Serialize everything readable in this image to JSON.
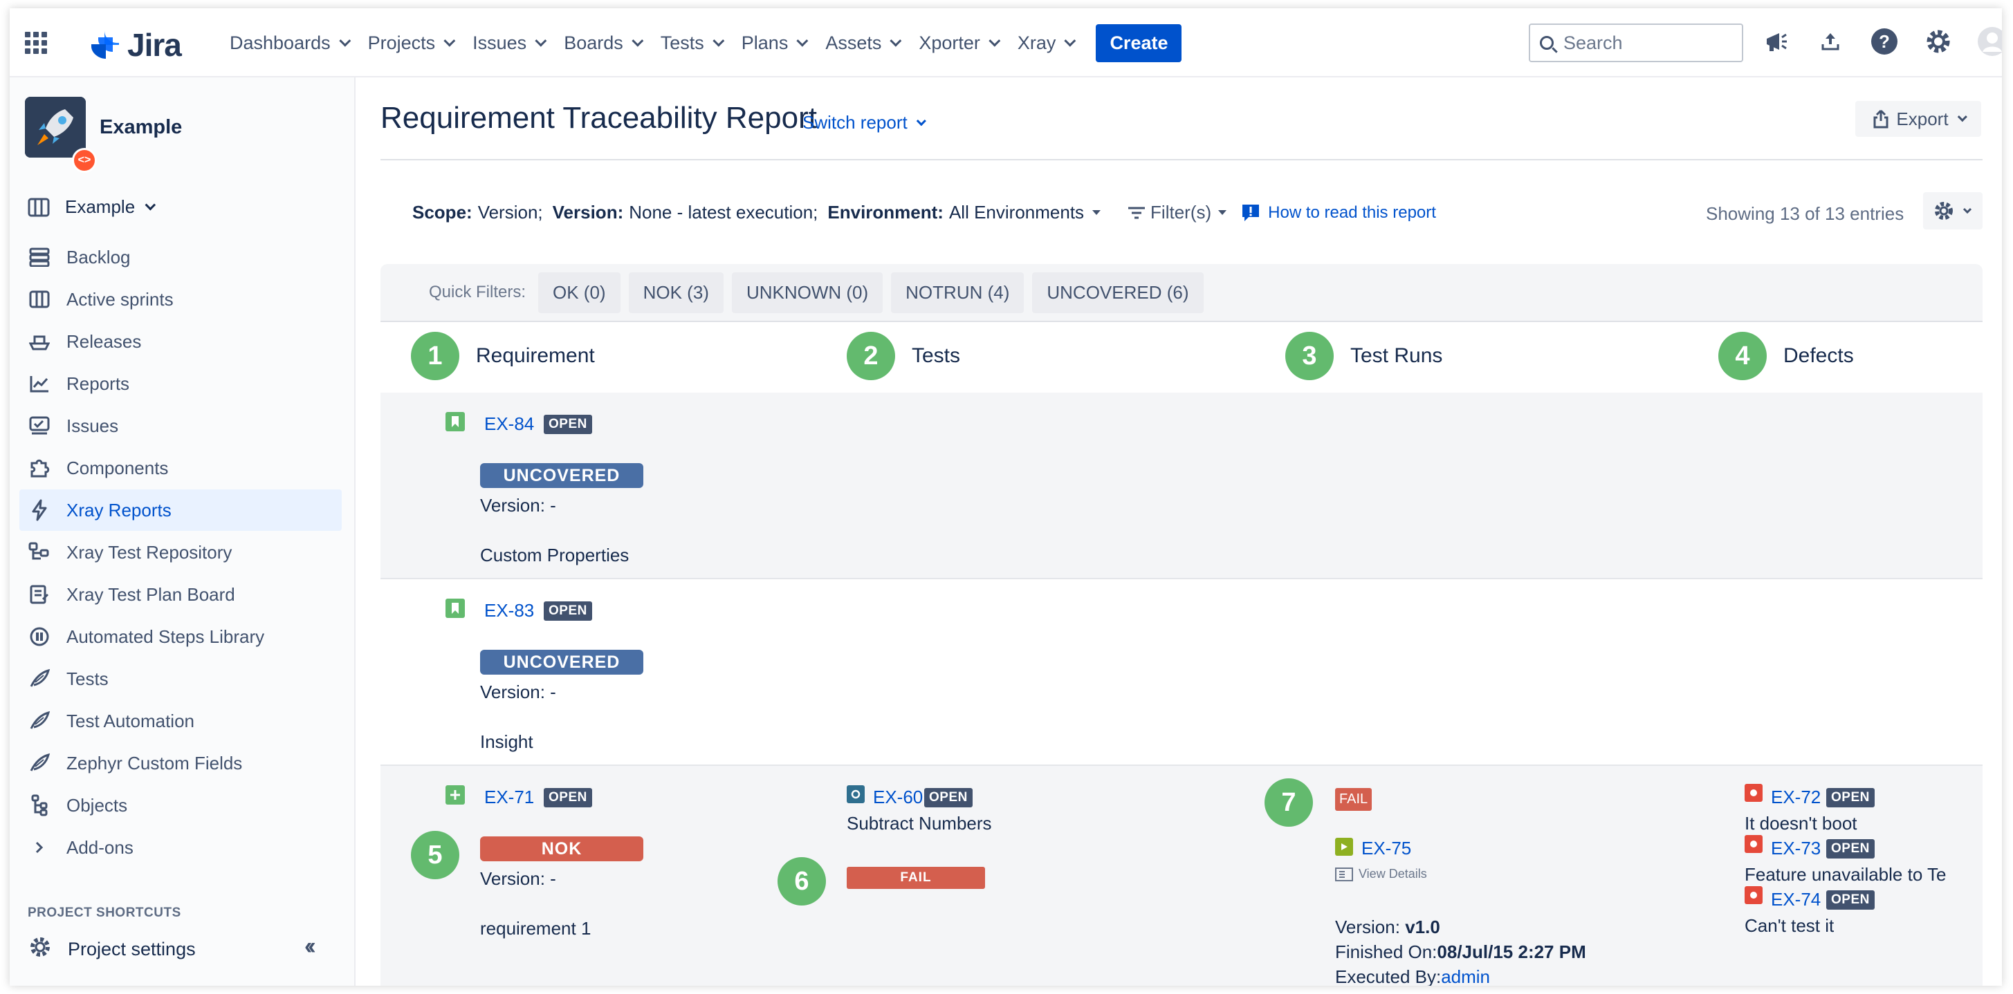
{
  "topnav": {
    "logo_text": "Jira",
    "menu": [
      {
        "label": "Dashboards"
      },
      {
        "label": "Projects"
      },
      {
        "label": "Issues"
      },
      {
        "label": "Boards"
      },
      {
        "label": "Tests"
      },
      {
        "label": "Plans"
      },
      {
        "label": "Assets"
      },
      {
        "label": "Xporter"
      },
      {
        "label": "Xray"
      }
    ],
    "create_label": "Create",
    "search_placeholder": "Search"
  },
  "sidebar": {
    "project_name": "Example",
    "board_selector": "Example",
    "items": [
      {
        "label": "Backlog",
        "icon": "backlog-icon"
      },
      {
        "label": "Active sprints",
        "icon": "board-icon"
      },
      {
        "label": "Releases",
        "icon": "ship-icon"
      },
      {
        "label": "Reports",
        "icon": "chart-icon"
      },
      {
        "label": "Issues",
        "icon": "issues-icon"
      },
      {
        "label": "Components",
        "icon": "puzzle-icon"
      },
      {
        "label": "Xray Reports",
        "icon": "bolt-icon",
        "active": true
      },
      {
        "label": "Xray Test Repository",
        "icon": "repository-icon"
      },
      {
        "label": "Xray Test Plan Board",
        "icon": "plan-board-icon"
      },
      {
        "label": "Automated Steps Library",
        "icon": "library-icon"
      },
      {
        "label": "Tests",
        "icon": "feather-icon"
      },
      {
        "label": "Test Automation",
        "icon": "feather-icon"
      },
      {
        "label": "Zephyr Custom Fields",
        "icon": "feather-icon"
      },
      {
        "label": "Objects",
        "icon": "hierarchy-icon"
      },
      {
        "label": "Add-ons",
        "icon": "chevron-right-icon"
      }
    ],
    "shortcuts_header": "PROJECT SHORTCUTS",
    "project_settings": "Project settings"
  },
  "report": {
    "title": "Requirement Traceability Report",
    "switch_report": "Switch report",
    "export_label": "Export",
    "scope_label": "Scope:",
    "scope_value": "Version;",
    "version_label": "Version:",
    "version_value": "None - latest execution;",
    "environment_label": "Environment:",
    "environment_value": "All Environments",
    "filters_label": "Filter(s)",
    "how_to_read": "How to read this report",
    "showing": "Showing 13 of 13 entries",
    "quick_filters_label": "Quick Filters:",
    "quick_filters": [
      "OK (0)",
      "NOK (3)",
      "UNKNOWN (0)",
      "NOTRUN (4)",
      "UNCOVERED (6)"
    ],
    "columns": [
      {
        "num": "1",
        "label": "Requirement"
      },
      {
        "num": "2",
        "label": "Tests"
      },
      {
        "num": "3",
        "label": "Test Runs"
      },
      {
        "num": "4",
        "label": "Defects"
      }
    ],
    "rows": [
      {
        "key": "EX-84",
        "status": "OPEN",
        "coverage": "UNCOVERED",
        "version": "Version: -",
        "summary": "Custom Properties"
      },
      {
        "key": "EX-83",
        "status": "OPEN",
        "coverage": "UNCOVERED",
        "version": "Version: -",
        "summary": "Insight"
      },
      {
        "key": "EX-71",
        "status": "OPEN",
        "coverage": "NOK",
        "version": "Version: -",
        "summary": "requirement 1",
        "test": {
          "key": "EX-60",
          "status": "OPEN",
          "summary": "Subtract Numbers",
          "result": "FAIL"
        },
        "run": {
          "result": "FAIL",
          "key": "EX-75",
          "view_details": "View Details",
          "version_label": "Version:",
          "version_value": "v1.0",
          "finished_label": "Finished On:",
          "finished_value": "08/Jul/15 2:27 PM",
          "executed_label": "Executed By:",
          "executed_value": "admin"
        },
        "defects": [
          {
            "key": "EX-72",
            "status": "OPEN",
            "summary": "It doesn't boot"
          },
          {
            "key": "EX-73",
            "status": "OPEN",
            "summary": "Feature unavailable to Te"
          },
          {
            "key": "EX-74",
            "status": "OPEN",
            "summary": "Can't test it"
          }
        ]
      }
    ],
    "callouts": [
      "5",
      "6",
      "7"
    ]
  },
  "colors": {
    "accent": "#0052cc",
    "uncovered": "#4a6fa5",
    "nok": "#d45f4e",
    "callout_green": "#63ba6e"
  }
}
